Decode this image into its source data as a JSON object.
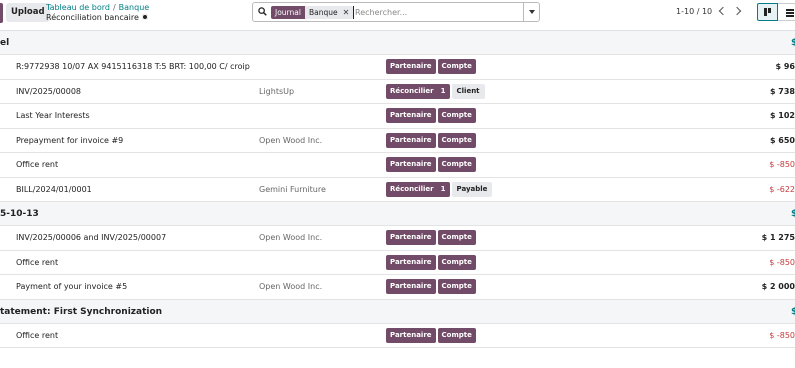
{
  "toolbar": {
    "upload_label": "Upload",
    "breadcrumb": [
      "Tableau de bord",
      "Banque"
    ],
    "current_title": "Réconciliation bancaire"
  },
  "search": {
    "facet_tag": "Journal",
    "facet_value": "Banque",
    "facet_remove": "✕",
    "placeholder": "Rechercher..."
  },
  "pager": {
    "text": "1-10 / 10"
  },
  "colors": {
    "brand": "#714b67",
    "accent": "#017e84",
    "negative": "#c53b3b"
  },
  "groups": [
    {
      "title": "el",
      "amount": "$",
      "rows": [
        {
          "label": "R:9772938 10/07 AX 9415116318 T:5 BRT: 100,00 C/ croip",
          "partner": "",
          "buttons": [
            {
              "label": "Partenaire"
            },
            {
              "label": "Compte"
            }
          ],
          "amount": "$ 96"
        },
        {
          "label": "INV/2025/00008",
          "partner": "LightsUp",
          "buttons": [
            {
              "label": "Réconcilier",
              "count": "1"
            }
          ],
          "tag": "Client",
          "amount": "$ 738"
        },
        {
          "label": "Last Year Interests",
          "partner": "",
          "buttons": [
            {
              "label": "Partenaire"
            },
            {
              "label": "Compte"
            }
          ],
          "amount": "$ 102"
        },
        {
          "label": "Prepayment for invoice #9",
          "partner": "Open Wood Inc.",
          "buttons": [
            {
              "label": "Partenaire"
            },
            {
              "label": "Compte"
            }
          ],
          "amount": "$ 650"
        },
        {
          "label": "Office rent",
          "partner": "",
          "buttons": [
            {
              "label": "Partenaire"
            },
            {
              "label": "Compte"
            }
          ],
          "amount": "$ -850",
          "negative": true
        },
        {
          "label": "BILL/2024/01/0001",
          "partner": "Gemini Furniture",
          "buttons": [
            {
              "label": "Réconcilier",
              "count": "1"
            }
          ],
          "tag": "Payable",
          "amount": "$ -622",
          "negative": true
        }
      ]
    },
    {
      "title": "5-10-13",
      "amount": "$",
      "rows": [
        {
          "label": "INV/2025/00006 and INV/2025/00007",
          "partner": "Open Wood Inc.",
          "buttons": [
            {
              "label": "Partenaire"
            },
            {
              "label": "Compte"
            }
          ],
          "amount": "$ 1 275"
        },
        {
          "label": "Office rent",
          "partner": "",
          "buttons": [
            {
              "label": "Partenaire"
            },
            {
              "label": "Compte"
            }
          ],
          "amount": "$ -850",
          "negative": true
        },
        {
          "label": "Payment of your invoice #5",
          "partner": "Open Wood Inc.",
          "buttons": [
            {
              "label": "Partenaire"
            },
            {
              "label": "Compte"
            }
          ],
          "amount": "$ 2 000"
        }
      ]
    },
    {
      "title": "tatement: First Synchronization",
      "amount": "$",
      "rows": [
        {
          "label": "Office rent",
          "partner": "",
          "buttons": [
            {
              "label": "Partenaire"
            },
            {
              "label": "Compte"
            }
          ],
          "amount": "$ -850",
          "negative": true
        }
      ]
    }
  ]
}
